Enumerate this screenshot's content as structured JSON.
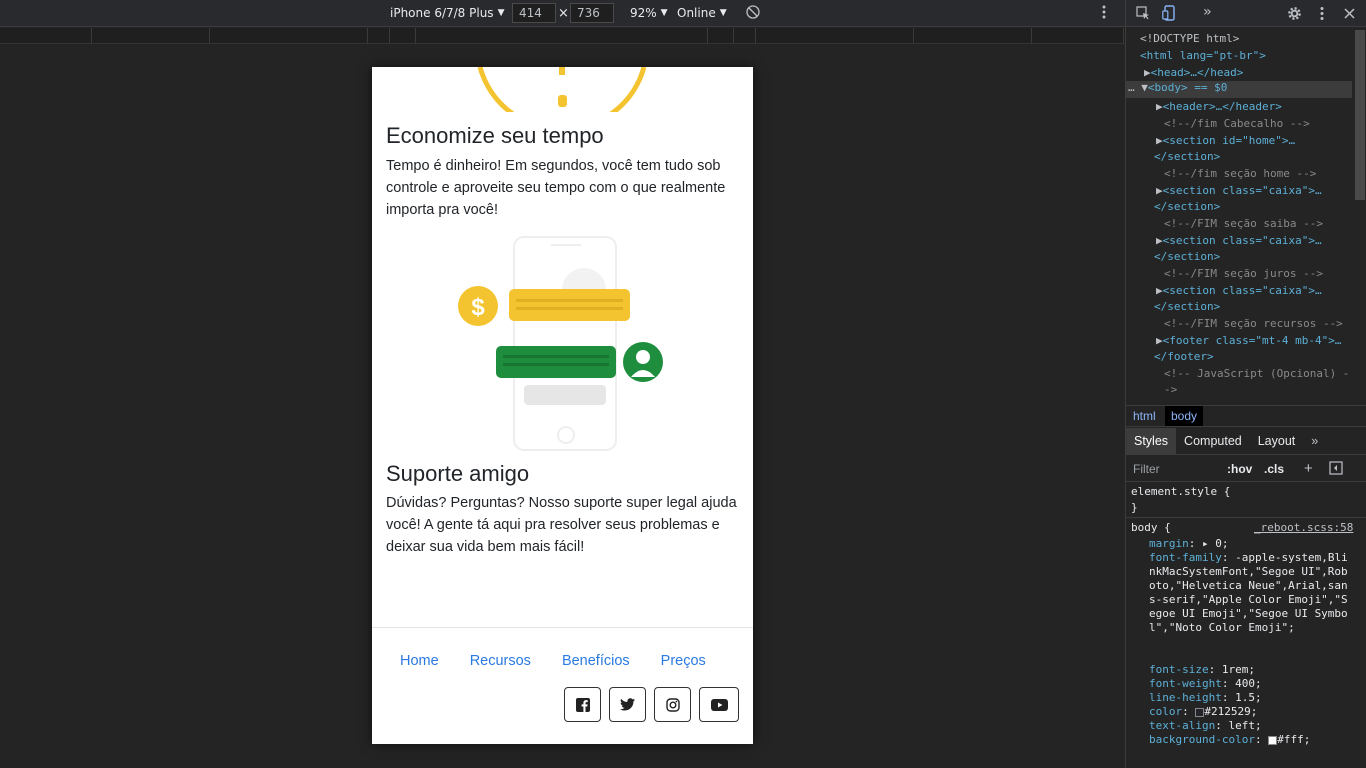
{
  "device_toolbar": {
    "device": "iPhone 6/7/8 Plus",
    "width": "414",
    "height": "736",
    "times": "×",
    "zoom": "92%",
    "network": "Online"
  },
  "page": {
    "sections": [
      {
        "title": "Economize seu tempo",
        "text": "Tempo é dinheiro! Em segundos, você tem tudo sob controle e aproveite seu tempo com o que realmente importa pra você!"
      },
      {
        "title": "Suporte amigo",
        "text": "Dúvidas? Perguntas? Nosso suporte super legal ajuda você! A gente tá aqui pra resolver seus problemas e deixar sua vida bem mais fácil!"
      }
    ],
    "illustration": {
      "dollar": "$"
    },
    "footer": {
      "links": [
        "Home",
        "Recursos",
        "Benefícios",
        "Preços"
      ],
      "social": [
        "facebook-icon",
        "twitter-icon",
        "instagram-icon",
        "youtube-icon"
      ]
    }
  },
  "colors": {
    "accent_yellow": "#f4c430",
    "accent_green": "#1e8e3e",
    "link": "#2a7ae2"
  },
  "devtools": {
    "dom_lines": [
      {
        "t": "<!DOCTYPE html>"
      },
      {
        "t": "<html lang=\"pt-br\">"
      },
      {
        "t": "<head>…</head>"
      },
      {
        "t": "<body> == $0"
      },
      {
        "t": "<header>…</header>"
      },
      {
        "t": "<!--/fim Cabecalho -->"
      },
      {
        "t": "<section id=\"home\">…"
      },
      {
        "t": "</section>"
      },
      {
        "t": "<!--/fim seção home -->"
      },
      {
        "t": "<section class=\"caixa\">…"
      },
      {
        "t": "</section>"
      },
      {
        "t": "<!--/FIM seção saiba -->"
      },
      {
        "t": "<section class=\"caixa\">…"
      },
      {
        "t": "</section>"
      },
      {
        "t": "<!--/FIM seção juros -->"
      },
      {
        "t": "<section class=\"caixa\">…"
      },
      {
        "t": "</section>"
      },
      {
        "t": "<!--/FIM seção recursos -->"
      },
      {
        "t": "<footer class=\"mt-4 mb-4\">…"
      },
      {
        "t": "</footer>"
      },
      {
        "t": "<!-- JavaScript (Opcional) -"
      },
      {
        "t": "->"
      }
    ],
    "breadcrumbs": [
      "html",
      "body"
    ],
    "tabs": [
      "Styles",
      "Computed",
      "Layout"
    ],
    "filter_placeholder": "Filter",
    "hov": ":hov",
    "cls": ".cls",
    "element_style": "element.style {",
    "brace_close": "}",
    "body_rule": {
      "selector": "body {",
      "source": "_reboot.scss:58",
      "props": [
        {
          "name": "margin",
          "value": "▸ 0;"
        },
        {
          "name": "font-family",
          "value": "-apple-system,BlinkMacSystemFont,\"Segoe UI\",Roboto,\"Helvetica Neue\",Arial,sans-serif,\"Apple Color Emoji\",\"Segoe UI Emoji\",\"Segoe UI Symbol\",\"Noto Color Emoji\";"
        },
        {
          "name": "font-size",
          "value": "1rem;"
        },
        {
          "name": "font-weight",
          "value": "400;"
        },
        {
          "name": "line-height",
          "value": "1.5;"
        },
        {
          "name": "color",
          "value": "#212529;"
        },
        {
          "name": "text-align",
          "value": "left;"
        },
        {
          "name": "background-color",
          "value": "#fff;"
        }
      ]
    }
  }
}
